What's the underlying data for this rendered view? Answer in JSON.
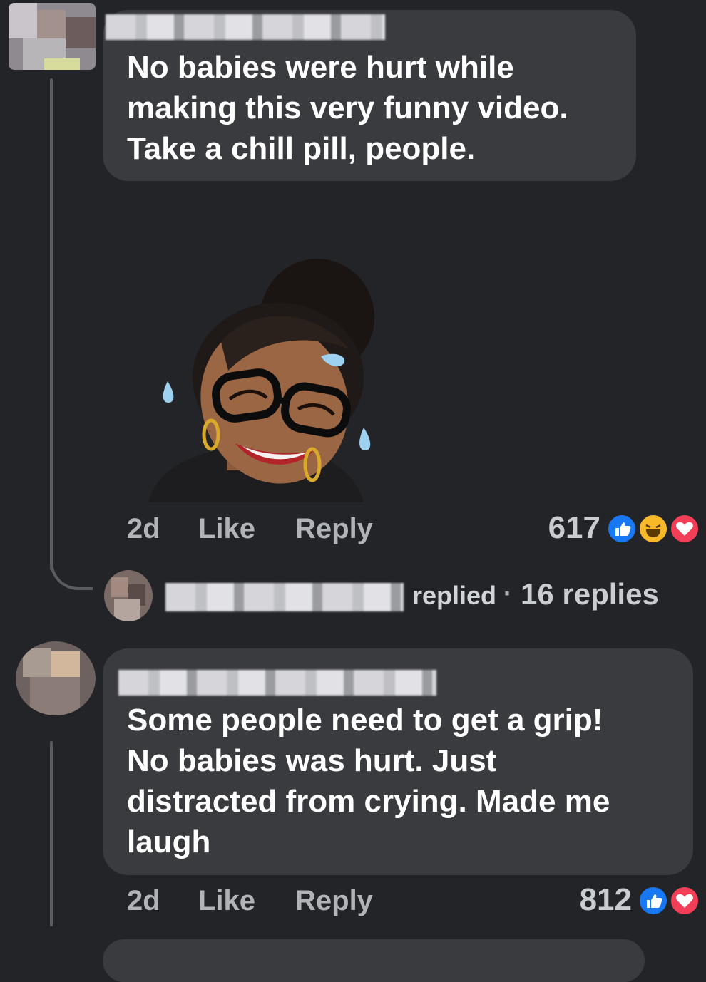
{
  "comments": [
    {
      "text": "No babies were hurt while\nmaking this very funny video.\nTake a chill pill, people.",
      "time": "2d",
      "like_label": "Like",
      "reply_label": "Reply",
      "reaction_count": "617",
      "reactions": [
        "like-icon",
        "haha-icon",
        "love-icon"
      ],
      "sticker": "laughing-memoji-sticker"
    },
    {
      "text": "Some  people need to get a grip!\nNo babies was hurt. Just\ndistracted from crying. Made me\nlaugh",
      "time": "2d",
      "like_label": "Like",
      "reply_label": "Reply",
      "reaction_count": "812",
      "reactions": [
        "like-icon",
        "love-icon"
      ]
    }
  ],
  "reply_summary": {
    "replied_label": "replied",
    "separator": "·",
    "replies_count": "16 replies"
  },
  "colors": {
    "background": "#232428",
    "bubble": "#3a3b3f",
    "like_blue": "#1877f2",
    "love_red": "#f33e58",
    "haha_yellow": "#f7b928"
  }
}
